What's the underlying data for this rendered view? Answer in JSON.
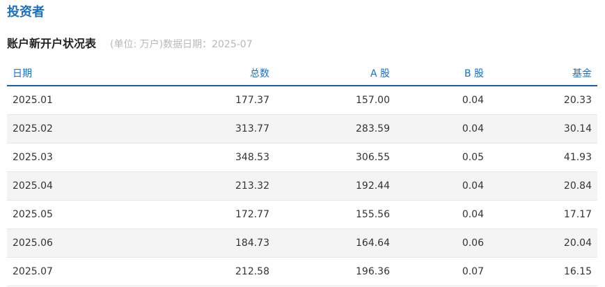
{
  "section_title": "投资者",
  "table_title": "账户新开户状况表",
  "table_note": "(单位: 万户)数据日期：2025-07",
  "columns": [
    "日期",
    "总数",
    "A 股",
    "B 股",
    "基金"
  ],
  "rows": [
    [
      "2025.01",
      "177.37",
      "157.00",
      "0.04",
      "20.33"
    ],
    [
      "2025.02",
      "313.77",
      "283.59",
      "0.04",
      "30.14"
    ],
    [
      "2025.03",
      "348.53",
      "306.55",
      "0.05",
      "41.93"
    ],
    [
      "2025.04",
      "213.32",
      "192.44",
      "0.04",
      "20.84"
    ],
    [
      "2025.05",
      "172.77",
      "155.56",
      "0.04",
      "17.17"
    ],
    [
      "2025.06",
      "184.73",
      "164.64",
      "0.06",
      "20.04"
    ],
    [
      "2025.07",
      "212.58",
      "196.36",
      "0.07",
      "16.15"
    ]
  ],
  "colors": {
    "accent": "#1a6fc4",
    "header_rule": "#1a5fa8",
    "row_alt": "#f4f4f4",
    "note": "#b8b8b8"
  }
}
